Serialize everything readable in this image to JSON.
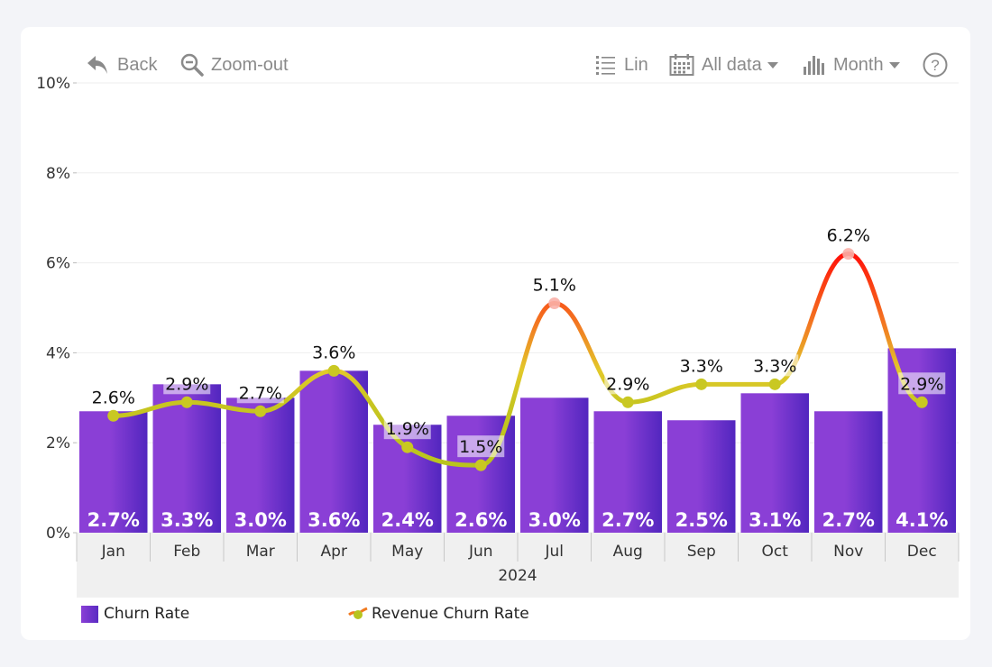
{
  "toolbar": {
    "back_label": "Back",
    "zoom_out_label": "Zoom-out",
    "scale_label": "Lin",
    "range_label": "All data",
    "period_label": "Month",
    "help_label": "?"
  },
  "legend": {
    "bar_series": "Churn Rate",
    "line_series": "Revenue Churn Rate"
  },
  "colors": {
    "bar_light": "#8a3fd6",
    "bar_dark": "#5528c0",
    "line_low": "#c4c51e",
    "line_mid": "#f08a20",
    "line_high": "#ff1a0a",
    "axis_band": "#f0f0f0",
    "grid": "#eeeeee"
  },
  "chart_data": {
    "type": "bar+line",
    "title": "",
    "xlabel": "2024",
    "ylabel": "",
    "ylim": [
      0,
      10
    ],
    "y_ticks": [
      "0%",
      "2%",
      "4%",
      "6%",
      "8%",
      "10%"
    ],
    "y_tick_values": [
      0,
      2,
      4,
      6,
      8,
      10
    ],
    "grid": true,
    "legend_position": "bottom-left",
    "categories": [
      "Jan",
      "Feb",
      "Mar",
      "Apr",
      "May",
      "Jun",
      "Jul",
      "Aug",
      "Sep",
      "Oct",
      "Nov",
      "Dec"
    ],
    "group_label": "2024",
    "series": [
      {
        "name": "Churn Rate",
        "type": "bar",
        "values": [
          2.7,
          3.3,
          3.0,
          3.6,
          2.4,
          2.6,
          3.0,
          2.7,
          2.5,
          3.1,
          2.7,
          4.1
        ],
        "labels": [
          "2.7%",
          "3.3%",
          "3.0%",
          "3.6%",
          "2.4%",
          "2.6%",
          "3.0%",
          "2.7%",
          "2.5%",
          "3.1%",
          "2.7%",
          "4.1%"
        ]
      },
      {
        "name": "Revenue Churn Rate",
        "type": "line",
        "values": [
          2.6,
          2.9,
          2.7,
          3.6,
          1.9,
          1.5,
          5.1,
          2.9,
          3.3,
          3.3,
          6.2,
          2.9
        ],
        "labels": [
          "2.6%",
          "2.9%",
          "2.7%",
          "3.6%",
          "1.9%",
          "1.5%",
          "5.1%",
          "2.9%",
          "3.3%",
          "3.3%",
          "6.2%",
          "2.9%"
        ]
      }
    ]
  }
}
